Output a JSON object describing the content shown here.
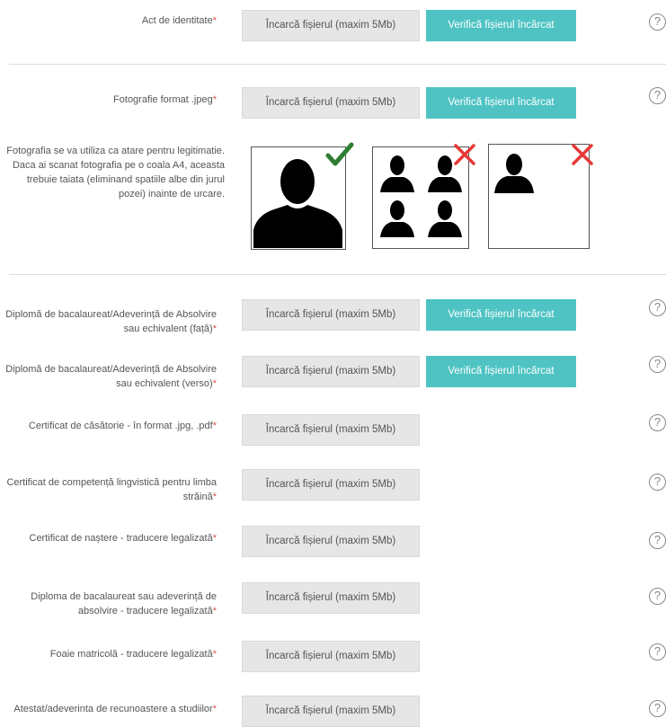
{
  "upload_label": "Încarcă fișierul (maxim 5Mb)",
  "verify_label": "Verifică fișierul încărcat",
  "help_glyph": "?",
  "required_mark": "*",
  "fields": [
    {
      "label": "Act de identitate"
    },
    {
      "label": "Fotografie format .jpeg"
    },
    {
      "label": "Diplomă de bacalaureat/Adeverință de Absolvire sau echivalent (față)"
    },
    {
      "label": "Diplomă de bacalaureat/Adeverință de Absolvire sau echivalent (verso)"
    },
    {
      "label": "Certificat de căsătorie - în format .jpg, .pdf"
    },
    {
      "label": "Certificat de competență lingvistică pentru limba străină"
    },
    {
      "label": "Certificat de naștere - traducere legalizată"
    },
    {
      "label": "Diploma de bacalaureat sau adeverință de absolvire - traducere legalizată"
    },
    {
      "label": "Foaie matricolă - traducere legalizată"
    },
    {
      "label": "Atestat/adeverinta de recunoastere a studiilor"
    }
  ],
  "photo_note": "Fotografia se va utiliza ca atare pentru legitimatie. Daca ai scanat fotografia pe o coala A4, aceasta trebuie taiata (eliminand spatiile albe din jurul pozei) inainte de urcare.",
  "colors": {
    "accent": "#4fc3c3",
    "check": "#2e7d32",
    "cross": "#e53935",
    "required": "#d9534f"
  }
}
